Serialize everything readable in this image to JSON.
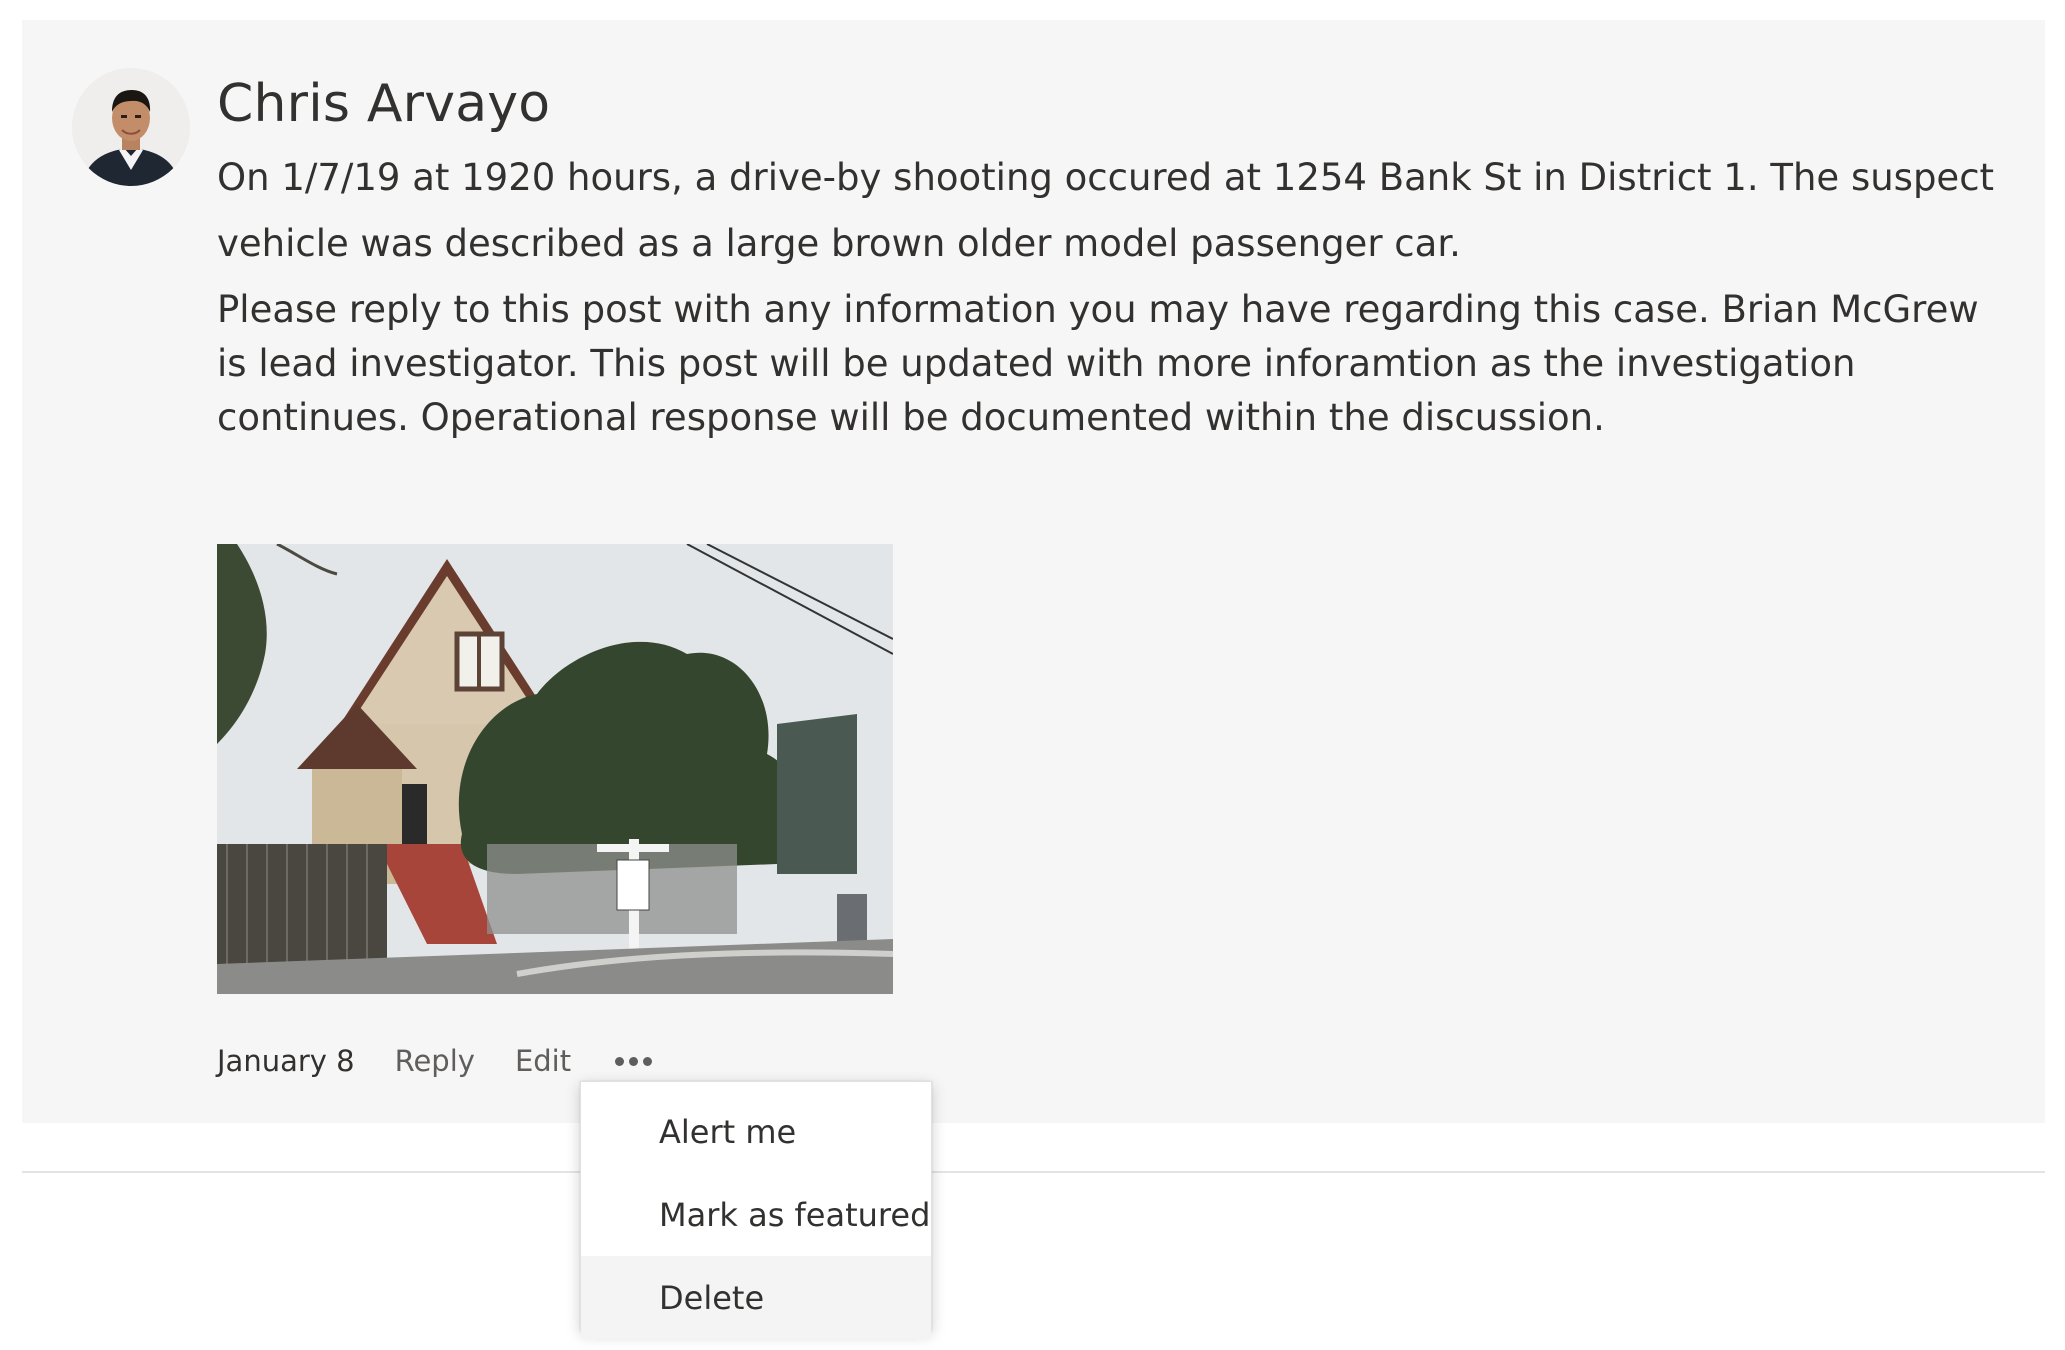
{
  "post": {
    "author": "Chris Arvayo",
    "paragraph1": "On 1/7/19 at 1920 hours, a drive-by shooting occured at 1254 Bank St in District 1.  The suspect vehicle was described as a large brown older model passenger car.",
    "paragraph2": "Please reply to this post with any information you may have regarding this case.  Brian McGrew is lead investigator.  This post will be updated with more inforamtion as the investigation continues.  Operational response will be documented within the discussion.",
    "date": "January 8",
    "reply_label": "Reply",
    "edit_label": "Edit",
    "more_icon": "more-horizontal-icon"
  },
  "menu": {
    "items": [
      {
        "label": "Alert me"
      },
      {
        "label": "Mark as featured"
      },
      {
        "label": "Delete",
        "hovered": true
      }
    ]
  },
  "colors": {
    "card_background": "#f6f6f6",
    "text_primary": "#323130",
    "text_secondary": "#605e5c",
    "menu_hover": "#f4f4f4"
  }
}
